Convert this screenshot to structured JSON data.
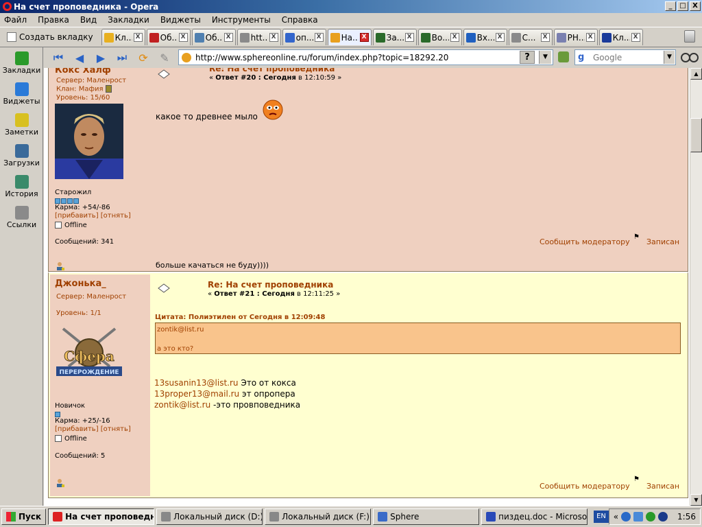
{
  "window": {
    "title": "На счет проповедника - Opera",
    "buttons": {
      "minimize": "_",
      "maximize": "□",
      "close": "X"
    }
  },
  "menu": [
    "Файл",
    "Правка",
    "Вид",
    "Закладки",
    "Виджеты",
    "Инструменты",
    "Справка"
  ],
  "tabbar": {
    "new_tab_label": "Создать вкладку",
    "tabs": [
      {
        "label": "Кл...",
        "icon": "smiley-icon",
        "color": "#e8b020"
      },
      {
        "label": "Об...",
        "icon": "m-icon",
        "color": "#c02020"
      },
      {
        "label": "Об...",
        "icon": "ds-icon",
        "color": "#5080b0"
      },
      {
        "label": "htt...",
        "icon": "page-icon",
        "color": "#8a8a8a"
      },
      {
        "label": "оп...",
        "icon": "g-icon",
        "color": "#3366cc"
      },
      {
        "label": "На...",
        "icon": "smiley-icon",
        "color": "#e8a020",
        "active": true
      },
      {
        "label": "За...",
        "icon": "walker-icon",
        "color": "#2a6a2a"
      },
      {
        "label": "Во...",
        "icon": "walker-icon",
        "color": "#2a6a2a"
      },
      {
        "label": "Вх...",
        "icon": "at-icon",
        "color": "#2060c0"
      },
      {
        "label": "С...",
        "icon": "page-icon",
        "color": "#8a8a8a"
      },
      {
        "label": "РН...",
        "icon": "php-icon",
        "color": "#7a80b0"
      },
      {
        "label": "Кл...",
        "icon": "grad-icon",
        "color": "#1a3a9a"
      }
    ],
    "close_glyph": "X"
  },
  "sidebar": [
    {
      "label": "Закладки",
      "icon": "bookmark-icon",
      "color": "#2a9a2a"
    },
    {
      "label": "Виджеты",
      "icon": "widgets-icon",
      "color": "#2a7ad8"
    },
    {
      "label": "Заметки",
      "icon": "notes-icon",
      "color": "#d8c020"
    },
    {
      "label": "Загрузки",
      "icon": "downloads-icon",
      "color": "#3a6a9a"
    },
    {
      "label": "История",
      "icon": "history-icon",
      "color": "#3a8a6a"
    },
    {
      "label": "Ссылки",
      "icon": "links-icon",
      "color": "#8a8a8a"
    }
  ],
  "nav": {
    "address": "http://www.sphereonline.ru/forum/index.php?topic=18292.20",
    "search_placeholder": "Google",
    "q_label": "?",
    "google_glyph": "g"
  },
  "posts": [
    {
      "author": "Кокс Халф",
      "server": "Сервер: Маленрост",
      "clan": "Клан: Мафия",
      "level": "Уровень: 15/60",
      "rank": "Старожил",
      "karma": "Карма: +54/-86",
      "karma_links": {
        "add": "[прибавить]",
        "sub": "[отнять]"
      },
      "status": "Offline",
      "messages": "Сообщений: 341",
      "title": "Re: На счет проповедника",
      "meta_prefix": "« ",
      "meta_reply": "Ответ #20 : Сегодня",
      "meta_time": " в 12:10:59 »",
      "body": "какое то древнее мыло",
      "signature": "больше качаться не буду))))",
      "report": "Сообщить модератору",
      "saved": "Записан"
    },
    {
      "author": "Джонька_",
      "server": "Сервер: Маленрост",
      "level": "Уровень: 1/1",
      "rank": "Новичок",
      "karma": "Карма: +25/-16",
      "karma_links": {
        "add": "[прибавить]",
        "sub": "[отнять]"
      },
      "status": "Offline",
      "messages": "Сообщений: 5",
      "title": "Re: На счет проповедника",
      "meta_prefix": "« ",
      "meta_reply": "Ответ #21 : Сегодня",
      "meta_time": " в 12:11:25 »",
      "quote_header": "Цитата: Полиэтилен от Сегодня в 12:09:48",
      "quote_lines": [
        "zontik@list.ru",
        "",
        "а это кто?"
      ],
      "body_lines": [
        {
          "email": "13susanin13@list.ru",
          "text": " Это от кокса"
        },
        {
          "email": "13proper13@mail.ru",
          "text": " эт опропера"
        },
        {
          "email": "zontik@list.ru",
          "text": " -это провповедника"
        }
      ],
      "logo": {
        "line1": "Сфера",
        "line2": "ПЕРЕРОЖДЕНИЕ"
      },
      "report": "Сообщить модератору",
      "saved": "Записан"
    }
  ],
  "taskbar": {
    "start": "Пуск",
    "buttons": [
      {
        "label": "На счет проповедни...",
        "active": true,
        "icon": "opera-icon",
        "color": "#d22"
      },
      {
        "label": "Локальный диск (D:)",
        "icon": "drive-icon",
        "color": "#888"
      },
      {
        "label": "Локальный диск (F:)",
        "icon": "drive-icon",
        "color": "#888"
      },
      {
        "label": "Sphere",
        "icon": "globe-icon",
        "color": "#3a6ac8"
      },
      {
        "label": "пиздец.doc - Microsoft ...",
        "icon": "word-icon",
        "color": "#2a4ab8"
      }
    ],
    "lang": "EN",
    "tray_expand": "«",
    "clock": "1:56"
  }
}
